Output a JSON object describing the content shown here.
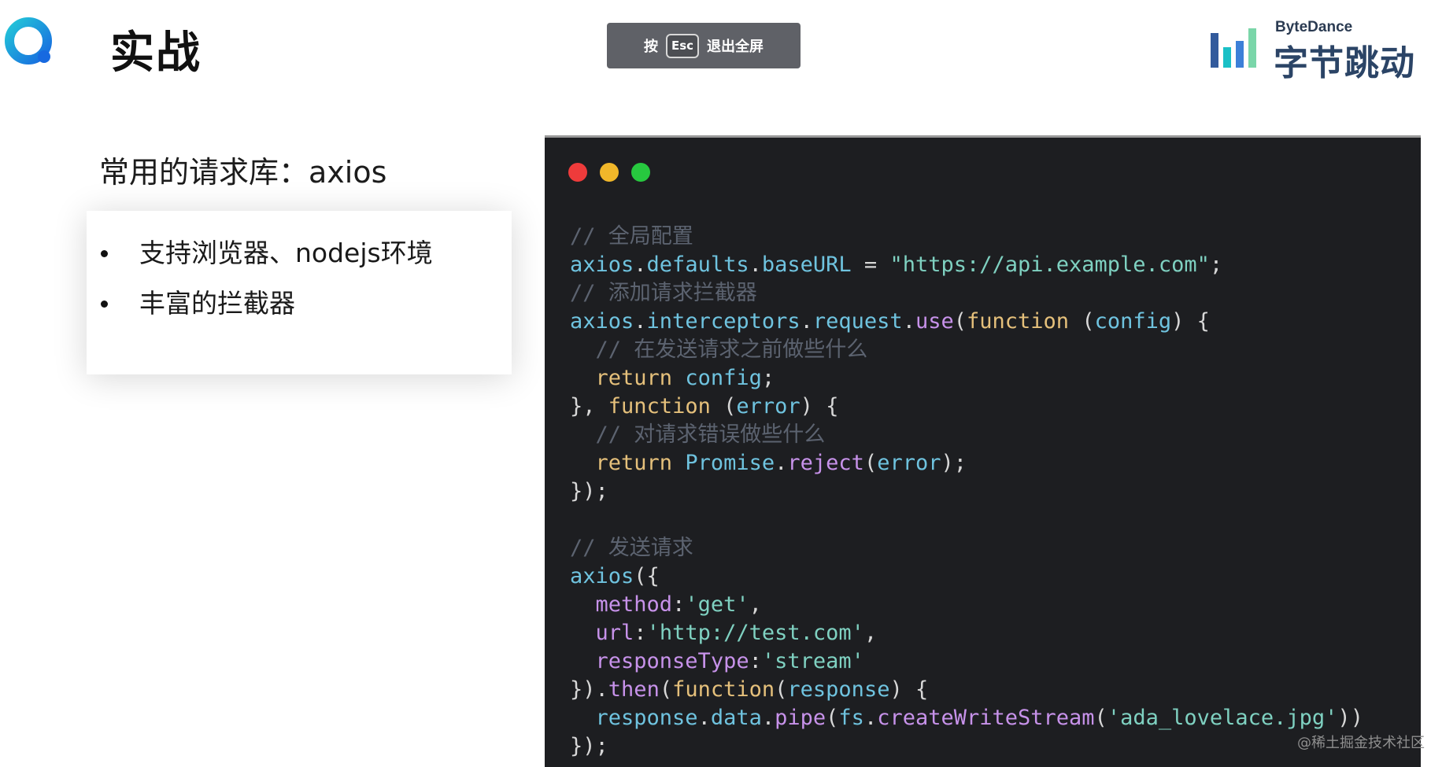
{
  "header": {
    "title": "实战",
    "esc_banner": {
      "prefix": "按",
      "key": "Esc",
      "suffix": "退出全屏"
    },
    "brand": {
      "en": "ByteDance",
      "cn": "字节跳动"
    }
  },
  "left": {
    "subtitle": "常用的请求库：axios",
    "bullets": [
      "支持浏览器、nodejs环境",
      "丰富的拦截器"
    ]
  },
  "code_window": {
    "lights": [
      "#ee3b3b",
      "#f1b72a",
      "#27c93f"
    ],
    "lines": [
      "// 全局配置",
      "axios.defaults.baseURL = \"https://api.example.com\";",
      "// 添加请求拦截器",
      "axios.interceptors.request.use(function (config) {",
      "  // 在发送请求之前做些什么",
      "  return config;",
      "}, function (error) {",
      "  // 对请求错误做些什么",
      "  return Promise.reject(error);",
      "});",
      "",
      "// 发送请求",
      "axios({",
      "  method:'get',",
      "  url:'http://test.com',",
      "  responseType:'stream'",
      "}).then(function(response) {",
      "  response.data.pipe(fs.createWriteStream('ada_lovelace.jpg'))",
      "});"
    ]
  },
  "watermark": "@稀土掘金技术社区",
  "colors": {
    "brand_blue": "#1a8fe0",
    "code_bg": "#1d1e21",
    "banner_bg": "#5f6167"
  }
}
